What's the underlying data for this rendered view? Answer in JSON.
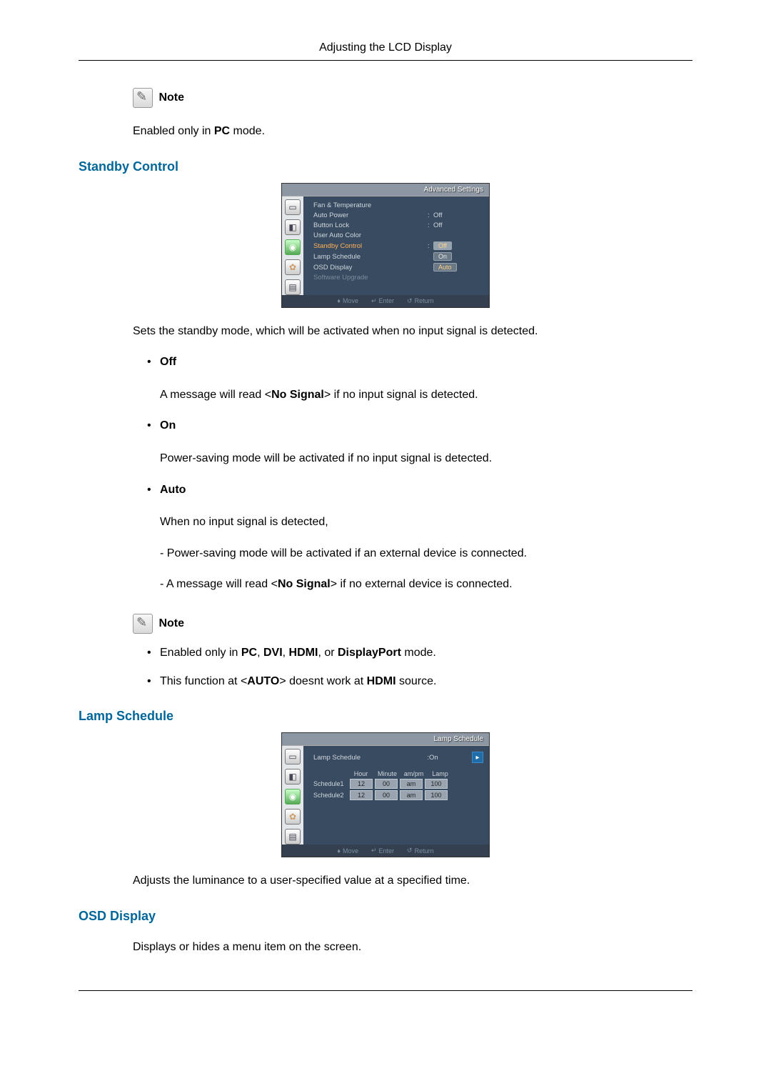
{
  "header": {
    "title": "Adjusting the LCD Display"
  },
  "note_label": "Note",
  "note1": {
    "prefix": "Enabled only in ",
    "bold1": "PC",
    "suffix": " mode."
  },
  "sections": {
    "standby": "Standby Control",
    "lamp": "Lamp Schedule",
    "osd": "OSD Display"
  },
  "osd1": {
    "title": "Advanced Settings",
    "rows": {
      "fan": "Fan & Temperature",
      "autopower": {
        "label": "Auto Power",
        "value": "Off"
      },
      "buttonlock": {
        "label": "Button Lock",
        "value": "Off"
      },
      "userauto": "User Auto Color",
      "standby": "Standby Control",
      "lamp": "Lamp Schedule",
      "osddisp": "OSD Display",
      "sw": "Software Upgrade"
    },
    "options": {
      "off": "Off",
      "on": "On",
      "auto": "Auto"
    },
    "footer": {
      "move": "Move",
      "enter": "Enter",
      "return": "Return"
    }
  },
  "standby_desc": "Sets the standby mode, which will be activated when no input signal is detected.",
  "standby_items": {
    "off_label": "Off",
    "off_desc_pre": "A message will read <",
    "off_desc_bold": "No Signal",
    "off_desc_post": "> if no input signal is detected.",
    "on_label": "On",
    "on_desc": "Power-saving mode will be activated if no input signal is detected.",
    "auto_label": "Auto",
    "auto_desc1": "When no input signal is detected,",
    "auto_sub1": "- Power-saving mode will be activated if an external device is connected.",
    "auto_sub2_pre": "- A message will read <",
    "auto_sub2_bold": "No Signal",
    "auto_sub2_post": "> if no external device is connected."
  },
  "note2": {
    "line1_pre": "Enabled only in ",
    "line1_b1": "PC",
    "line1_s1": ", ",
    "line1_b2": "DVI",
    "line1_s2": ", ",
    "line1_b3": "HDMI",
    "line1_s3": ", or ",
    "line1_b4": "DisplayPort",
    "line1_s4": " mode.",
    "line2_pre": "This function at <",
    "line2_b1": "AUTO",
    "line2_mid": "> doesnt work at ",
    "line2_b2": "HDMI",
    "line2_post": " source."
  },
  "osd2": {
    "title": "Lamp Schedule",
    "top": {
      "label": "Lamp Schedule",
      "value": "On"
    },
    "hdr": {
      "hour": "Hour",
      "minute": "Minute",
      "ampm": "am/pm",
      "lamp": "Lamp"
    },
    "s1": {
      "name": "Schedule1",
      "hour": "12",
      "minute": "00",
      "ampm": "am",
      "lamp": "100"
    },
    "s2": {
      "name": "Schedule2",
      "hour": "12",
      "minute": "00",
      "ampm": "am",
      "lamp": "100"
    },
    "footer": {
      "move": "Move",
      "enter": "Enter",
      "return": "Return"
    }
  },
  "lamp_desc": "Adjusts the luminance to a user-specified value at a specified time.",
  "osd_desc": "Displays or hides a menu item on the screen."
}
